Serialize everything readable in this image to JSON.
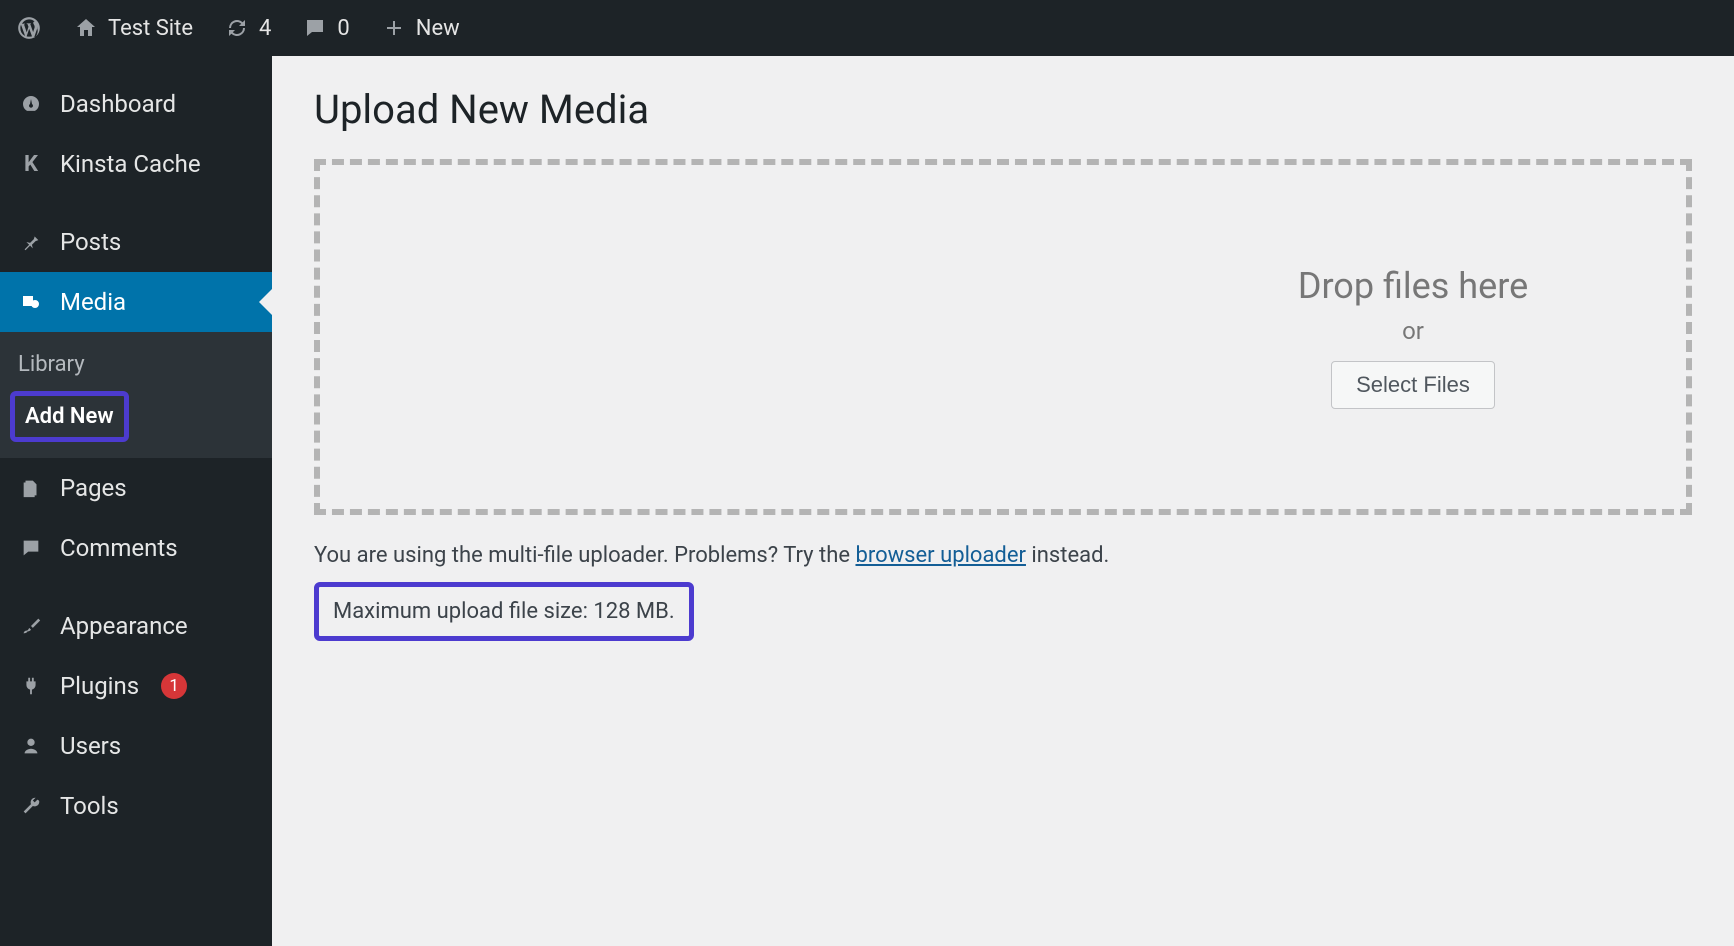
{
  "toolbar": {
    "site_name": "Test Site",
    "updates_count": "4",
    "comments_count": "0",
    "new_label": "New"
  },
  "sidebar": {
    "items": [
      {
        "label": "Dashboard"
      },
      {
        "label": "Kinsta Cache"
      },
      {
        "label": "Posts"
      },
      {
        "label": "Media"
      },
      {
        "label": "Pages"
      },
      {
        "label": "Comments"
      },
      {
        "label": "Appearance"
      },
      {
        "label": "Plugins",
        "badge": "1"
      },
      {
        "label": "Users"
      },
      {
        "label": "Tools"
      }
    ],
    "media_submenu": {
      "library": "Library",
      "add_new": "Add New"
    }
  },
  "main": {
    "title": "Upload New Media",
    "drop_text": "Drop files here",
    "or_text": "or",
    "select_files": "Select Files",
    "note_prefix": "You are using the multi-file uploader. Problems? Try the ",
    "note_link": "browser uploader",
    "note_suffix": " instead.",
    "max_upload": "Maximum upload file size: 128 MB."
  }
}
